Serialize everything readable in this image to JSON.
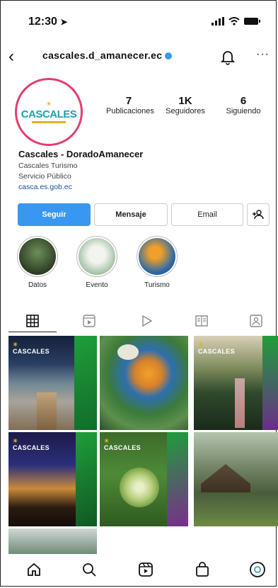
{
  "status_bar": {
    "time": "12:30",
    "location_arrow": "location-arrow-icon",
    "signal": "signal-icon",
    "wifi": "wifi-icon",
    "battery": "battery-icon"
  },
  "header": {
    "handle": "cascales.d_amanecer.ec",
    "verified": true
  },
  "profile": {
    "logo_text": "CASCALES",
    "stats": [
      {
        "value": "7",
        "label": "Publicaciones"
      },
      {
        "value": "1K",
        "label": "Seguidores"
      },
      {
        "value": "6",
        "label": "Siguiendo"
      }
    ],
    "name": "Cascales - DoradoAmanecer",
    "category": "Cascales Turismo",
    "category2": "Servicio Público",
    "link": "casca.es.gob.ec"
  },
  "actions": {
    "follow": "Seguir",
    "message": "Mensaje",
    "email": "Email"
  },
  "highlights": [
    {
      "label": "Datos",
      "color_a": "#4c6b3b",
      "color_b": "#2e3f25"
    },
    {
      "label": "Evento",
      "color_a": "#d9e4d6",
      "color_b": "#7a9f7d"
    },
    {
      "label": "Turismo",
      "color_a": "#e38a20",
      "color_b": "#2c6aa8"
    }
  ],
  "colors": {
    "accent": "#3897f0",
    "ring": "#e23d71",
    "brand_teal": "#1c9fb1",
    "brand_gold": "#e3b21c",
    "brand_green": "#1f9d3a"
  },
  "grid": {
    "tag_text": "CASCALES"
  },
  "bottom_nav": [
    "home-icon",
    "search-icon",
    "reels-icon",
    "shop-icon",
    "profile-icon"
  ]
}
